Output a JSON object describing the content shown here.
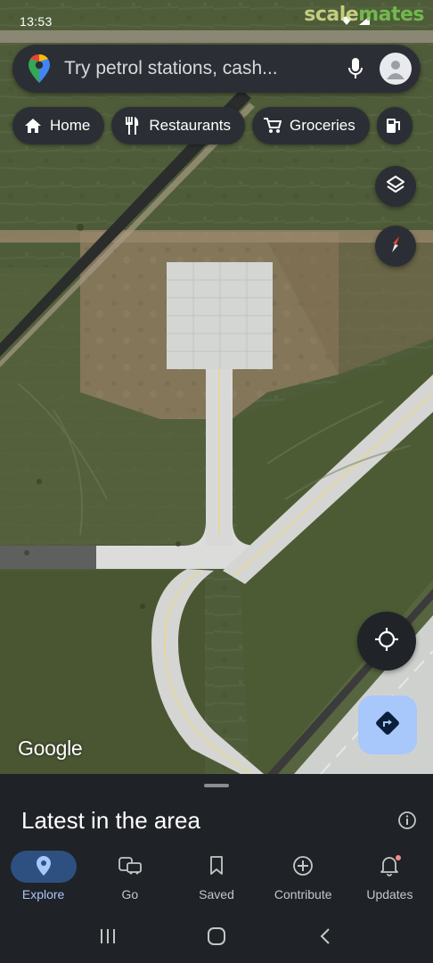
{
  "status_bar": {
    "time": "13:53",
    "icons": [
      "notification-icon",
      "gallery-icon",
      "location-icon",
      "wifi-icon",
      "signal-icon",
      "battery-icon"
    ]
  },
  "watermark": {
    "part1": "scale",
    "part2": "mates"
  },
  "search": {
    "placeholder": "Try petrol stations, cash..."
  },
  "chips": [
    {
      "label": "Home",
      "icon": "home-icon"
    },
    {
      "label": "Restaurants",
      "icon": "restaurant-icon"
    },
    {
      "label": "Groceries",
      "icon": "cart-icon"
    },
    {
      "label": "",
      "icon": "petrol-icon"
    }
  ],
  "map": {
    "attribution": "Google",
    "view": "satellite"
  },
  "sheet": {
    "title": "Latest in the area"
  },
  "nav": [
    {
      "label": "Explore",
      "icon": "explore-pin-icon",
      "active": true
    },
    {
      "label": "Go",
      "icon": "commute-icon",
      "active": false
    },
    {
      "label": "Saved",
      "icon": "bookmark-icon",
      "active": false
    },
    {
      "label": "Contribute",
      "icon": "add-circle-icon",
      "active": false
    },
    {
      "label": "Updates",
      "icon": "bell-icon",
      "active": false,
      "badge": true
    }
  ],
  "colors": {
    "accent": "#a8c7fa",
    "active_pill": "#2d5080",
    "surface": "#2b2f35",
    "sheet": "#1f2226"
  }
}
